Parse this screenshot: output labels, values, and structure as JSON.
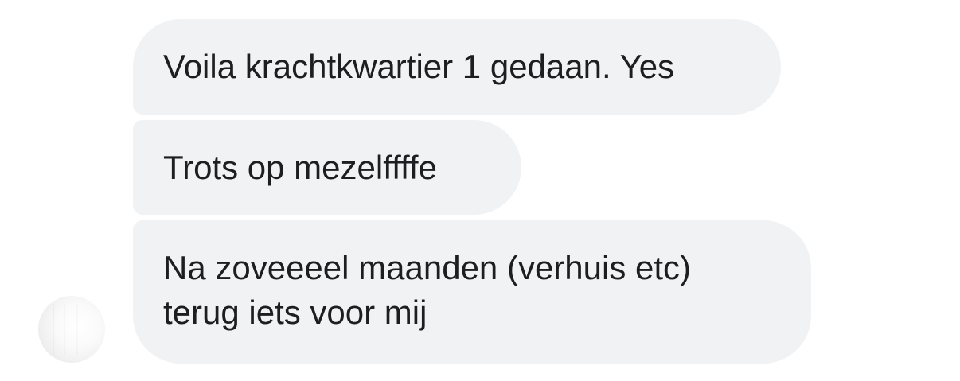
{
  "messages": [
    {
      "text": "Voila krachtkwartier 1 gedaan. Yes"
    },
    {
      "text": "Trots op mezelffffe"
    },
    {
      "text": "Na zoveeeel maanden (verhuis etc)\nterug iets voor mij"
    }
  ],
  "colors": {
    "bubble_background": "#f1f2f4",
    "text": "#1c1e21",
    "page_background": "#ffffff"
  },
  "icons": {
    "avatar": "sender-avatar"
  }
}
